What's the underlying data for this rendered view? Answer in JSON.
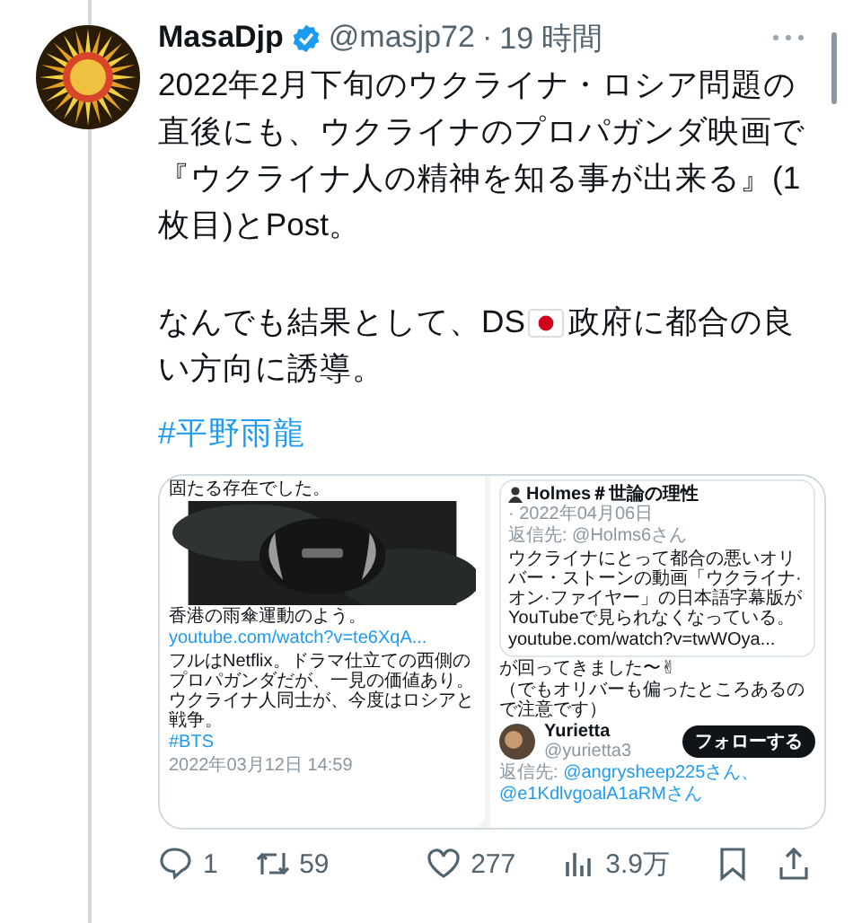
{
  "author": {
    "name": "MasaDjp",
    "verified": true,
    "handle": "@masjp72",
    "separator": "·",
    "time": "19 時間"
  },
  "body": [
    {
      "segments": [
        {
          "kind": "text",
          "text": "2022年2月下旬のウクライナ・ロシア問題の直後にも、ウクライナのプロパガンダ映画で『ウクライナ人の精神を知る事が出来る』(1枚目)とPost。"
        }
      ]
    },
    {
      "segments": [
        {
          "kind": "text",
          "text": "なんでも結果として、DS"
        },
        {
          "kind": "flag"
        },
        {
          "kind": "text",
          "text": "政府に都合の良"
        },
        {
          "kind": "text",
          "text": "い方向に誘導。"
        }
      ]
    },
    {
      "segments": [
        {
          "kind": "hashtag",
          "text": "#平野雨龍"
        }
      ]
    }
  ],
  "media": {
    "left": {
      "top_text": "固たる存在でした。",
      "caption": "香港の雨傘運動のよう。",
      "link": "youtube.com/watch?v=te6XqA...",
      "text": "フルはNetflix。ドラマ仕立ての西側のプロパガンダだが、一見の価値あり。ウクライナ人同士が、今度はロシアと戦争。",
      "hashtag": "#BTS",
      "date": "2022年03月12日 14:59"
    },
    "quote": {
      "name": "Holmes＃世論の理性",
      "date": "· 2022年04月06日",
      "reply_to": "返信先: @Holms6さん",
      "text": "ウクライナにとって都合の悪いオリバー・ストーンの動画「ウクライナ·オン·ファイヤー」の日本語字幕版がYouTubeで見られなくなっている。",
      "link": "youtube.com/watch?v=twWOya..."
    },
    "reply": {
      "text": "が回ってきました〜✌",
      "note": "（でもオリバーも偏ったところあるので注意です）"
    },
    "user": {
      "name": "Yurietta",
      "handle": "@yurietta3",
      "follow": "フォローする",
      "reply_label": "返信先: ",
      "reply_to": "@angrysheep225さん、@e1KdlvgoalA1aRMさん"
    }
  },
  "actions": [
    {
      "kind": "reply",
      "count": "1"
    },
    {
      "kind": "retweet",
      "count": "59"
    },
    {
      "kind": "like",
      "count": "277"
    },
    {
      "kind": "views",
      "count": "3.9万"
    },
    {
      "kind": "bookmark"
    },
    {
      "kind": "share"
    }
  ]
}
